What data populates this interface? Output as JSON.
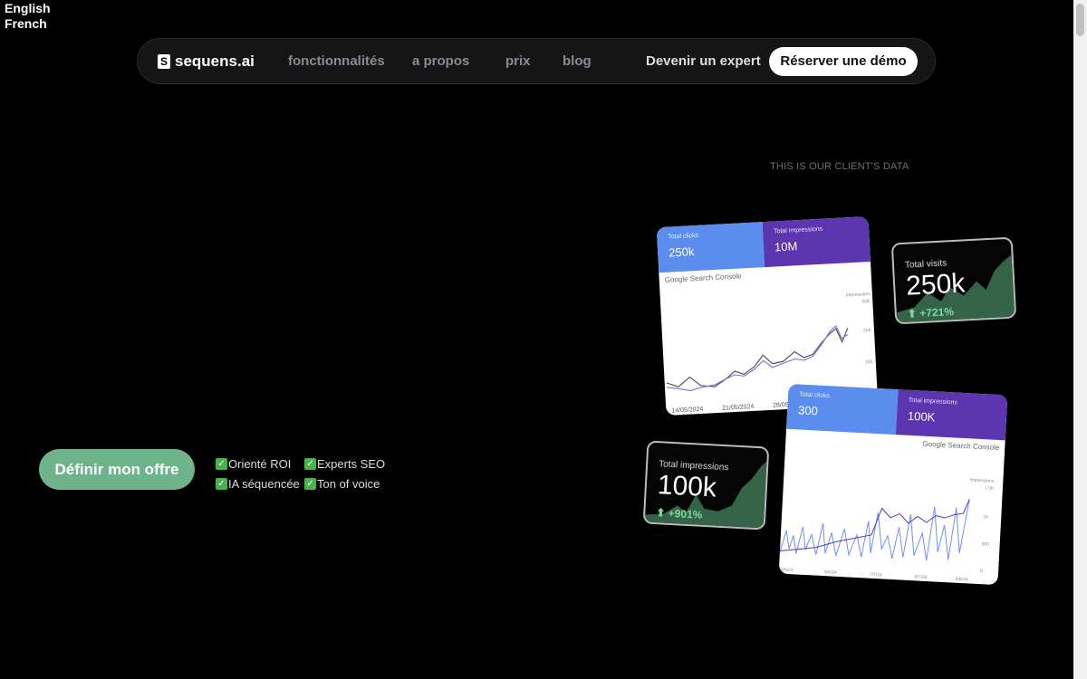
{
  "languages": [
    "English",
    "French"
  ],
  "nav": {
    "logo": "sequens.ai",
    "links": [
      "fonctionnalités",
      "a propos",
      "prix",
      "blog"
    ],
    "expert": "Devenir un expert",
    "demo": "Réserver une démo"
  },
  "caption": "THIS IS OUR CLIENT'S DATA",
  "cta": "Définir mon offre",
  "checks": [
    "Orienté ROI",
    "Experts SEO",
    "IA séquencée",
    "Ton of voice"
  ],
  "card1": {
    "clicks_label": "Total clicks",
    "clicks": "250k",
    "impr_label": "Total impressions",
    "impr": "10M",
    "brand": "Google Search Console",
    "axis_title": "Impressions",
    "yticks": [
      "30K",
      "20K",
      "10K",
      "0"
    ],
    "xticks": [
      "14/05/2024",
      "21/05/2024",
      "28/05/2024"
    ]
  },
  "visits": {
    "title": "Total visits",
    "value": "250k",
    "growth": "+721%"
  },
  "card2": {
    "clicks_label": "Total clicks",
    "clicks": "300",
    "impr_label": "Total impressions",
    "impr": "100K",
    "brand": "Google Search Console",
    "axis_title": "Impressions",
    "yticks": [
      "1.5K",
      "1K",
      "500",
      "0"
    ],
    "xticks": [
      "5/5/24",
      "6/6/24",
      "7/7/24",
      "8/7/24",
      "9/8/24"
    ]
  },
  "impressions": {
    "title": "Total impressions",
    "value": "100k",
    "growth": "+901%"
  },
  "colors": {
    "cta": "#6fb38a",
    "clicks": "#5b8def",
    "impressions": "#5e35b1"
  }
}
